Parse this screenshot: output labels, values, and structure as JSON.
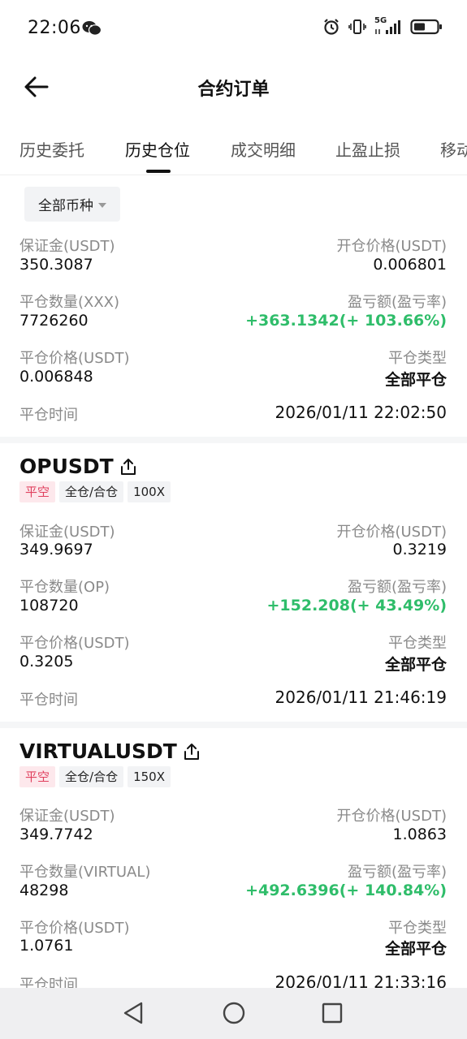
{
  "status_bar": {
    "time": "22:06",
    "network": "5G"
  },
  "header": {
    "title": "合约订单"
  },
  "tabs": [
    {
      "label": "历史委托"
    },
    {
      "label": "历史仓位"
    },
    {
      "label": "成交明细"
    },
    {
      "label": "止盈止损"
    },
    {
      "label": "移动"
    }
  ],
  "filter": {
    "label": "全部币种"
  },
  "labels": {
    "margin": "保证金(USDT)",
    "open_price": "开仓价格(USDT)",
    "pnl": "盈亏额(盈亏率)",
    "close_price": "平仓价格(USDT)",
    "close_type": "平仓类型",
    "close_time": "平仓时间"
  },
  "positions": [
    {
      "close_qty_label": "平仓数量(XXX)",
      "margin": "350.3087",
      "open_price": "0.006801",
      "close_qty": "7726260",
      "pnl": "+363.1342(+ 103.66%)",
      "close_price": "0.006848",
      "close_type": "全部平仓",
      "close_time": "2026/01/11 22:02:50"
    },
    {
      "symbol": "OPUSDT",
      "tags": [
        "平空",
        "全仓/合仓",
        "100X"
      ],
      "close_qty_label": "平仓数量(OP)",
      "margin": "349.9697",
      "open_price": "0.3219",
      "close_qty": "108720",
      "pnl": "+152.208(+ 43.49%)",
      "close_price": "0.3205",
      "close_type": "全部平仓",
      "close_time": "2026/01/11 21:46:19"
    },
    {
      "symbol": "VIRTUALUSDT",
      "tags": [
        "平空",
        "全仓/合仓",
        "150X"
      ],
      "close_qty_label": "平仓数量(VIRTUAL)",
      "margin": "349.7742",
      "open_price": "1.0863",
      "close_qty": "48298",
      "pnl": "+492.6396(+ 140.84%)",
      "close_price": "1.0761",
      "close_type": "全部平仓",
      "close_time": "2026/01/11 21:33:16"
    }
  ],
  "colors": {
    "profit_green": "#2fbd6a",
    "short_tag_red": "#e0405e"
  }
}
